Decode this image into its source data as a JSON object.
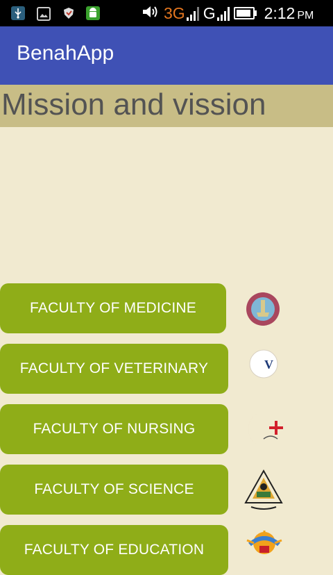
{
  "status_bar": {
    "network_primary": "3G",
    "network_secondary": "G",
    "time": "2:12",
    "ampm": "PM",
    "icons": [
      "usb-icon",
      "image-icon",
      "shield-icon",
      "android-icon",
      "volume-icon",
      "signal-icon",
      "battery-icon"
    ]
  },
  "app": {
    "title": "BenahApp",
    "primary_color": "#3f51b5",
    "background_color": "#f1ead0"
  },
  "section": {
    "heading": "Mission and vission",
    "band_color": "#c8bd86"
  },
  "faculties": [
    {
      "label": "FACULTY OF MEDICINE",
      "logo": "medicine-logo"
    },
    {
      "label": "FACULTY OF VETERINARY",
      "logo": "veterinary-logo"
    },
    {
      "label": "FACULTY OF NURSING",
      "logo": "nursing-logo"
    },
    {
      "label": "FACULTY OF SCIENCE",
      "logo": "science-logo"
    },
    {
      "label": "FACULTY OF EDUCATION",
      "logo": "education-logo"
    }
  ],
  "button_color": "#8fad18"
}
